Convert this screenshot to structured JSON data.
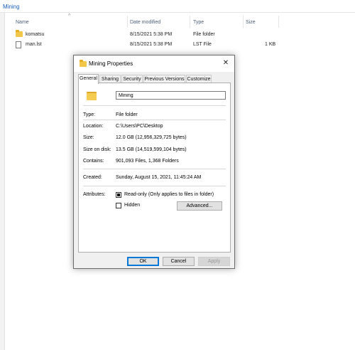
{
  "breadcrumb": "Mining",
  "columns": {
    "name": "Name",
    "date": "Date modified",
    "type": "Type",
    "size": "Size"
  },
  "sort_caret": "^",
  "files": [
    {
      "name": "komatsu",
      "date": "8/15/2021 5:38 PM",
      "type": "File folder",
      "size": "",
      "icon": "folder-icon"
    },
    {
      "name": "man.lst",
      "date": "8/15/2021 5:38 PM",
      "type": "LST File",
      "size": "1 KB",
      "icon": "file-icon"
    }
  ],
  "dialog": {
    "title": "Mining Properties",
    "close_glyph": "✕",
    "tabs": [
      "General",
      "Sharing",
      "Security",
      "Previous Versions",
      "Customize"
    ],
    "active_tab": "General",
    "folder_name": "Mining",
    "labels": {
      "type": "Type:",
      "location": "Location:",
      "size": "Size:",
      "size_on_disk": "Size on disk:",
      "contains": "Contains:",
      "created": "Created:",
      "attributes": "Attributes:"
    },
    "values": {
      "type": "File folder",
      "location": "C:\\Users\\PC\\Desktop",
      "size": "12.0 GB (12,956,329,725 bytes)",
      "size_on_disk": "13.5 GB (14,519,599,104 bytes)",
      "contains": "901,093 Files, 1,368 Folders",
      "created": "Sunday, August 15, 2021, 11:45:24 AM"
    },
    "attributes": {
      "readonly_label": "Read-only (Only applies to files in folder)",
      "readonly_state": "indeterminate",
      "hidden_label": "Hidden",
      "hidden_state": "unchecked",
      "advanced_label": "Advanced..."
    },
    "buttons": {
      "ok": "OK",
      "cancel": "Cancel",
      "apply": "Apply"
    }
  },
  "colors": {
    "accent": "#0078d7",
    "folder": "#f5cc52",
    "dialog_bg": "#f0f0f0"
  }
}
